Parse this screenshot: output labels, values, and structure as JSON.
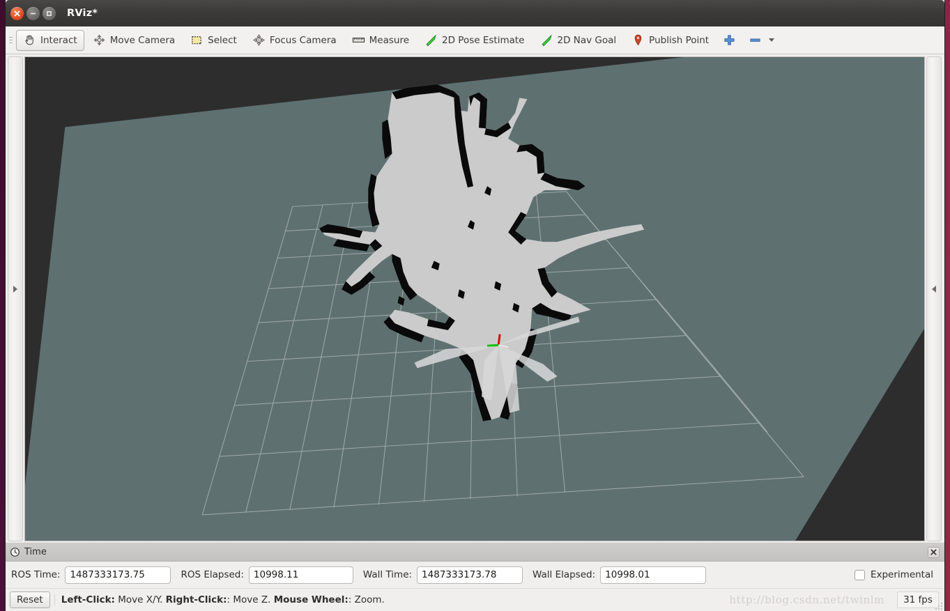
{
  "window": {
    "title": "RViz*",
    "controls": [
      {
        "name": "close",
        "glyph": "×"
      },
      {
        "name": "minimize",
        "glyph": "−"
      },
      {
        "name": "maximize",
        "glyph": "□"
      }
    ]
  },
  "toolbar": {
    "items": [
      {
        "label": "Interact",
        "icon": "hand-cursor-icon",
        "active": true
      },
      {
        "label": "Move Camera",
        "icon": "move-camera-icon",
        "active": false
      },
      {
        "label": "Select",
        "icon": "select-rectangle-icon",
        "active": false
      },
      {
        "label": "Focus Camera",
        "icon": "focus-camera-icon",
        "active": false
      },
      {
        "label": "Measure",
        "icon": "ruler-icon",
        "active": false
      },
      {
        "label": "2D Pose Estimate",
        "icon": "green-arrow-icon",
        "active": false
      },
      {
        "label": "2D Nav Goal",
        "icon": "green-arrow-icon",
        "active": false
      },
      {
        "label": "Publish Point",
        "icon": "map-pin-icon",
        "active": false
      }
    ],
    "add_tool_label": "",
    "remove_tool_label": ""
  },
  "viewport": {
    "sky_color": "#2d2d2d",
    "ground_color": "#5f7071",
    "grid_line_color": "#b9c2c2",
    "map_free_color": "#cccccc",
    "map_occupied_color": "#000000",
    "axes_x_color": "#cc0000",
    "axes_y_color": "#00bb00",
    "axes_z_color": "#dddddd"
  },
  "docks": {
    "left_collapsed": true,
    "right_collapsed": true
  },
  "time_panel": {
    "title": "Time",
    "close_label": "✖",
    "fields": [
      {
        "key": "ros_time",
        "label": "ROS Time:",
        "value": "1487333173.75",
        "width_class": "w-ros-time"
      },
      {
        "key": "ros_elapsed",
        "label": "ROS Elapsed:",
        "value": "10998.11",
        "width_class": "w-ros-elapsed"
      },
      {
        "key": "wall_time",
        "label": "Wall Time:",
        "value": "1487333173.78",
        "width_class": "w-wall-time"
      },
      {
        "key": "wall_elapsed",
        "label": "Wall Elapsed:",
        "value": "10998.01",
        "width_class": "w-wall-elapsed"
      }
    ],
    "experimental": {
      "label": "Experimental",
      "checked": false
    }
  },
  "status_bar": {
    "reset_label": "Reset",
    "hints": [
      {
        "bold": "Left-Click:",
        "rest": " Move X/Y. "
      },
      {
        "bold": "Right-Click:",
        "rest": ": Move Z. "
      },
      {
        "bold": "Mouse Wheel:",
        "rest": ": Zoom."
      }
    ],
    "fps": "31 fps",
    "watermark": "http://blog.csdn.net/twinlm"
  }
}
